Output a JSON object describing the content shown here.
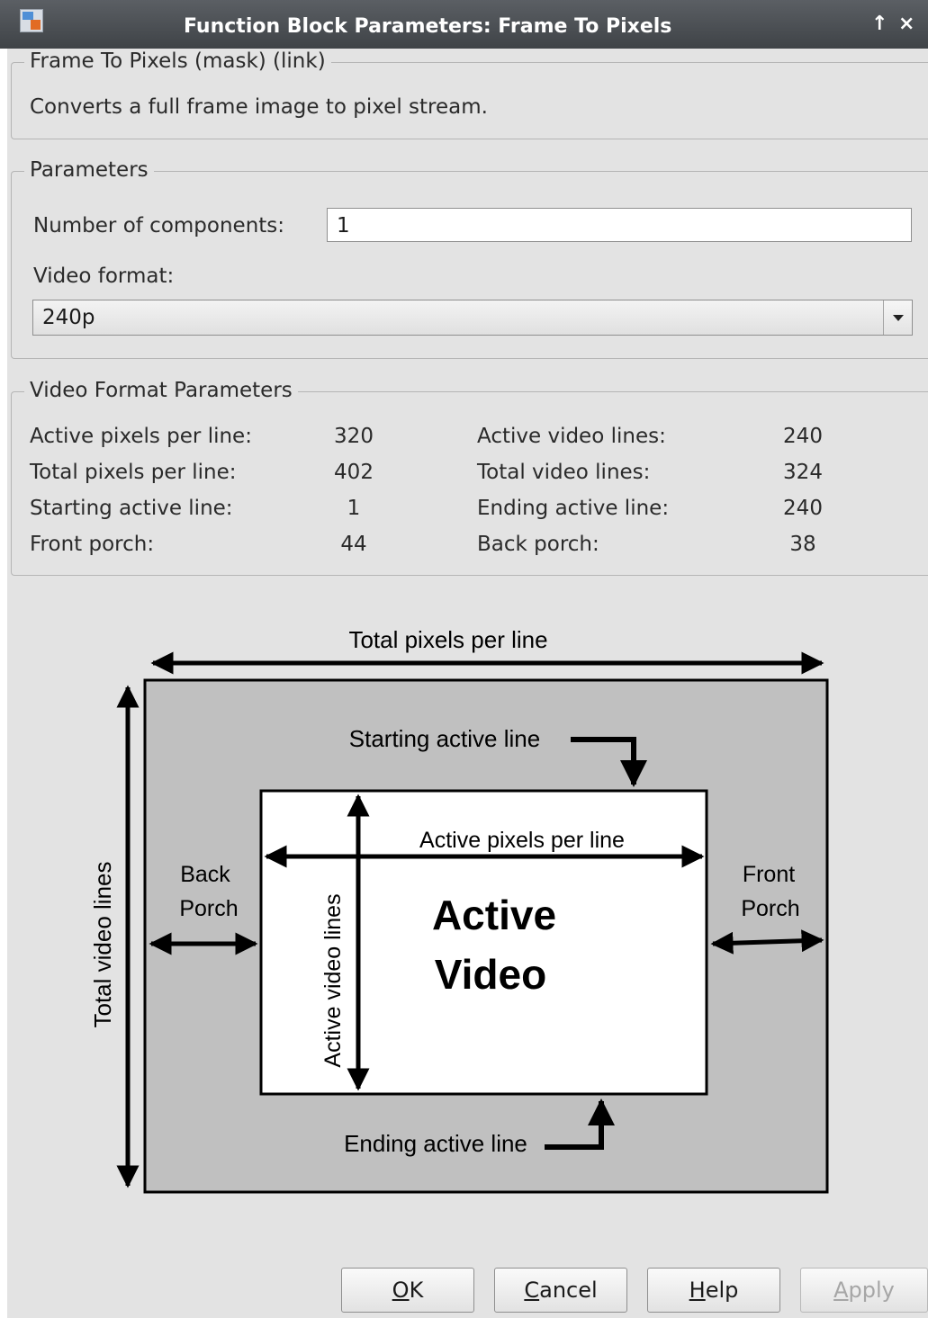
{
  "window": {
    "title": "Function Block Parameters: Frame To Pixels",
    "pin_glyph": "↑",
    "close_glyph": "×",
    "app_icon": "simulink-block-icon"
  },
  "mask": {
    "legend": "Frame To Pixels (mask) (link)",
    "description": "Converts a full frame image to pixel stream."
  },
  "parameters": {
    "legend": "Parameters",
    "num_components_label": "Number of components:",
    "num_components_value": "1",
    "video_format_label": "Video format:",
    "video_format_value": "240p"
  },
  "format_params": {
    "legend": "Video Format Parameters",
    "rows": [
      {
        "left_label": "Active pixels per line:",
        "left_value": "320",
        "right_label": "Active video lines:",
        "right_value": "240"
      },
      {
        "left_label": "Total pixels per line:",
        "left_value": "402",
        "right_label": "Total video lines:",
        "right_value": "324"
      },
      {
        "left_label": "Starting active line:",
        "left_value": "1",
        "right_label": "Ending active line:",
        "right_value": "240"
      },
      {
        "left_label": "Front porch:",
        "left_value": "44",
        "right_label": "Back porch:",
        "right_value": "38"
      }
    ]
  },
  "diagram": {
    "total_pixels_per_line": "Total pixels per line",
    "starting_active_line": "Starting active line",
    "active_pixels_per_line": "Active pixels per line",
    "back_porch_1": "Back",
    "back_porch_2": "Porch",
    "front_porch_1": "Front",
    "front_porch_2": "Porch",
    "active_video_1": "Active",
    "active_video_2": "Video",
    "total_video_lines": "Total video lines",
    "active_video_lines": "Active video lines",
    "ending_active_line": "Ending active line"
  },
  "buttons": {
    "ok_mn": "O",
    "ok_rest": "K",
    "cancel_mn": "C",
    "cancel_rest": "ancel",
    "help_mn": "H",
    "help_rest": "elp",
    "apply_mn": "A",
    "apply_rest": "pply"
  }
}
